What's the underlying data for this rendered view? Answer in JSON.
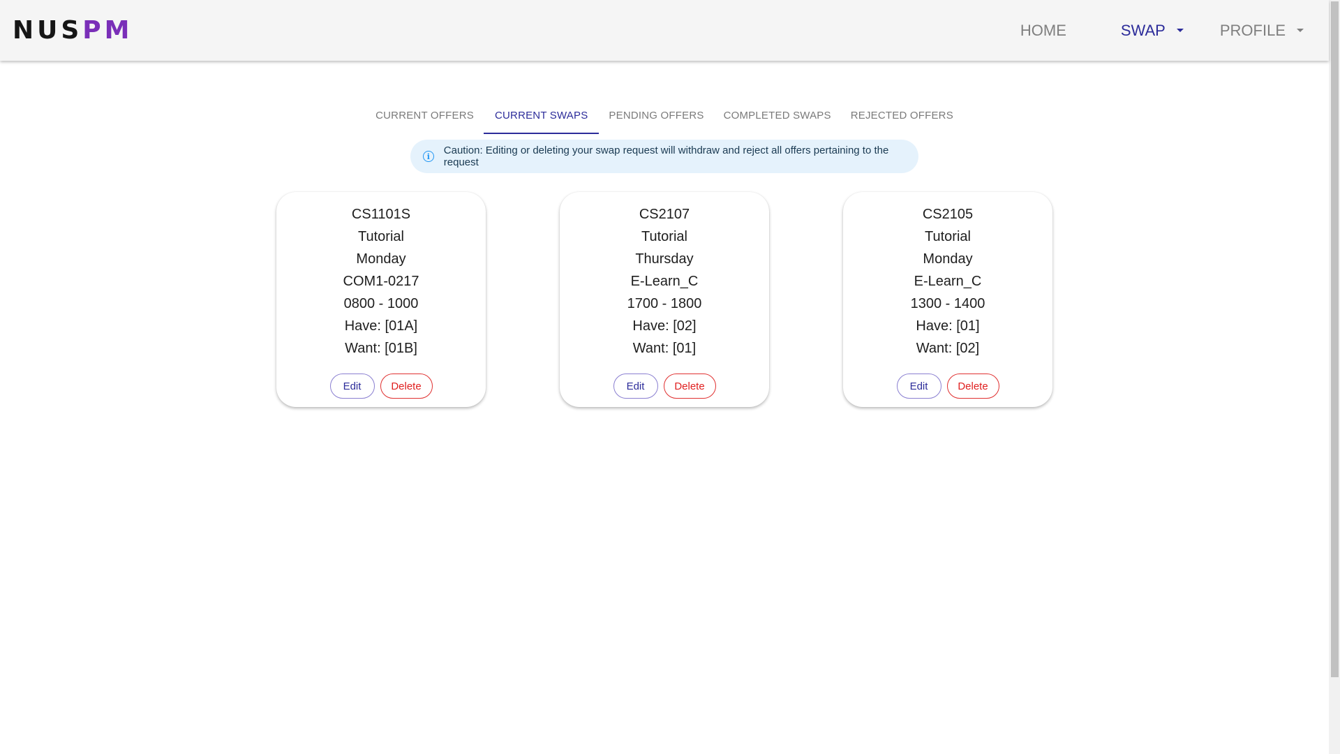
{
  "navbar": {
    "logo_part1": "NUS",
    "logo_part2": "PM",
    "links": [
      {
        "label": "HOME"
      },
      {
        "label": "SWAP"
      },
      {
        "label": "PROFILE"
      }
    ]
  },
  "tabs": [
    {
      "label": "CURRENT OFFERS",
      "active": false
    },
    {
      "label": "CURRENT SWAPS",
      "active": true
    },
    {
      "label": "PENDING OFFERS",
      "active": false
    },
    {
      "label": "COMPLETED SWAPS",
      "active": false
    },
    {
      "label": "REJECTED OFFERS",
      "active": false
    }
  ],
  "alert": {
    "icon": "info-icon",
    "text": "Caution: Editing or deleting your swap request will withdraw and reject all offers pertaining to the request"
  },
  "cards": [
    {
      "module": "CS1101S",
      "lesson_type": "Tutorial",
      "day": "Monday",
      "venue": "COM1-0217",
      "time": "0800 - 1000",
      "have": "Have: [01A]",
      "want": "Want: [01B]",
      "edit_label": "Edit",
      "delete_label": "Delete"
    },
    {
      "module": "CS2107",
      "lesson_type": "Tutorial",
      "day": "Thursday",
      "venue": "E-Learn_C",
      "time": "1700 - 1800",
      "have": "Have: [02]",
      "want": "Want: [01]",
      "edit_label": "Edit",
      "delete_label": "Delete"
    },
    {
      "module": "CS2105",
      "lesson_type": "Tutorial",
      "day": "Monday",
      "venue": "E-Learn_C",
      "time": "1300 - 1400",
      "have": "Have: [01]",
      "want": "Want: [02]",
      "edit_label": "Edit",
      "delete_label": "Delete"
    }
  ],
  "colors": {
    "accent": "#2c2c9a",
    "logo_pm": "#7a2fb8",
    "danger": "#e02020",
    "info": "#2196f3",
    "alert_bg": "#e5f2fc",
    "navbar_bg": "#f5f5f5"
  }
}
